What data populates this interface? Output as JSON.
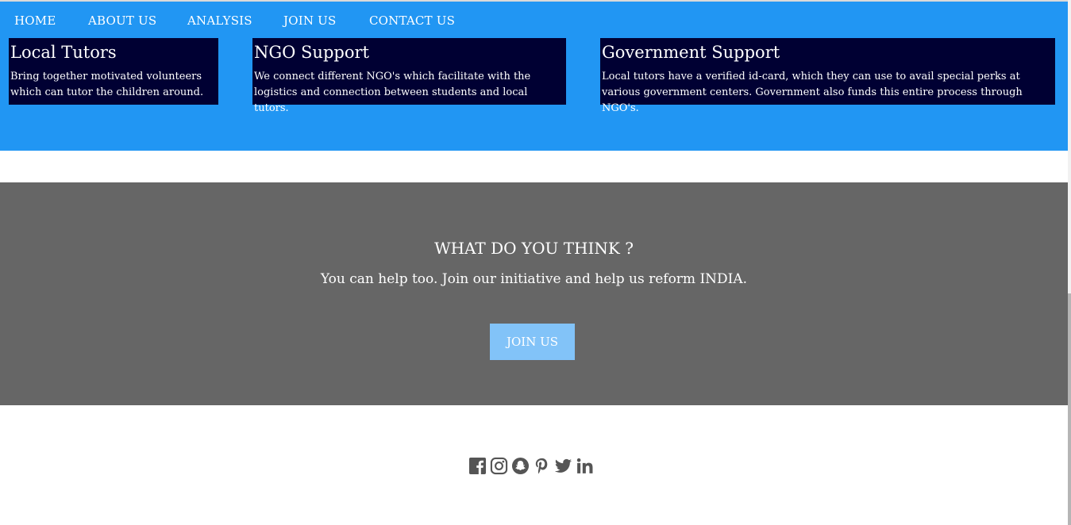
{
  "nav": {
    "items": [
      {
        "label": "HOME"
      },
      {
        "label": "ABOUT US"
      },
      {
        "label": "ANALYSIS"
      },
      {
        "label": "JOIN US"
      },
      {
        "label": "CONTACT US"
      }
    ]
  },
  "features": [
    {
      "title": "Local Tutors",
      "text": "Bring together motivated volunteers which can tutor the children around."
    },
    {
      "title": "NGO Support",
      "text": "We connect different NGO's which facilitate with the logistics and connection between students and local tutors."
    },
    {
      "title": "Government Support",
      "text": "Local tutors have a verified id-card, which they can use to avail special perks at various government centers. Government also funds this entire process through NGO's."
    }
  ],
  "cta": {
    "title": "WHAT DO YOU THINK ?",
    "text": "You can help too. Join our initiative and help us reform INDIA.",
    "button_label": "JOIN US"
  },
  "social": {
    "icons": [
      "facebook-icon",
      "instagram-icon",
      "snapchat-icon",
      "pinterest-icon",
      "twitter-icon",
      "linkedin-icon"
    ]
  },
  "colors": {
    "header_bg": "#2196f3",
    "card_bg": "#000033",
    "cta_bg": "#666666",
    "button_bg": "#82c3f8",
    "icon_color": "#555555"
  }
}
